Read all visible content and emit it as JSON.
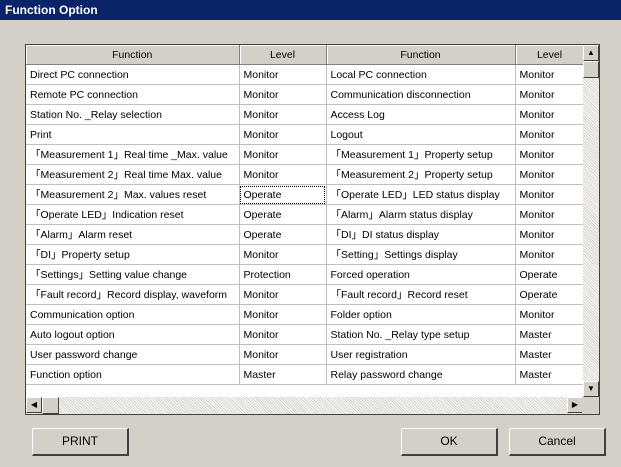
{
  "window": {
    "title": "Function Option"
  },
  "table": {
    "headers": [
      "Function",
      "Level",
      "Function",
      "Level"
    ],
    "rows": [
      [
        "Direct PC connection",
        "Monitor",
        "Local PC connection",
        "Monitor"
      ],
      [
        "Remote PC connection",
        "Monitor",
        "Communication disconnection",
        "Monitor"
      ],
      [
        "Station No. _Relay selection",
        "Monitor",
        "Access Log",
        "Monitor"
      ],
      [
        "Print",
        "Monitor",
        "Logout",
        "Monitor"
      ],
      [
        "「Measurement 1」Real time _Max. value",
        "Monitor",
        "「Measurement 1」Property setup",
        "Monitor"
      ],
      [
        "「Measurement 2」Real time  Max. value",
        "Monitor",
        "「Measurement 2」Property setup",
        "Monitor"
      ],
      [
        "「Measurement 2」Max. values reset",
        "Operate",
        "「Operate LED」LED status display",
        "Monitor"
      ],
      [
        "「Operate LED」Indication reset",
        "Operate",
        "「Alarm」Alarm status display",
        "Monitor"
      ],
      [
        "「Alarm」Alarm reset",
        "Operate",
        "「DI」DI status display",
        "Monitor"
      ],
      [
        "「DI」Property setup",
        "Monitor",
        "「Setting」Settings display",
        "Monitor"
      ],
      [
        "「Settings」Setting value change",
        "Protection",
        "Forced operation",
        "Operate"
      ],
      [
        "「Fault record」Record display, waveform",
        "Monitor",
        "「Fault record」Record reset",
        "Operate"
      ],
      [
        "Communication option",
        "Monitor",
        "Folder option",
        "Monitor"
      ],
      [
        "Auto logout option",
        "Monitor",
        "Station No. _Relay type setup",
        "Master"
      ],
      [
        "User password change",
        "Monitor",
        "User registration",
        "Master"
      ],
      [
        "Function option",
        "Master",
        "Relay password change",
        "Master"
      ]
    ]
  },
  "scrollbar": {
    "up_icon": "▲",
    "down_icon": "▼",
    "left_icon": "◀",
    "right_icon": "▶"
  },
  "buttons": {
    "print": "PRINT",
    "ok": "OK",
    "cancel": "Cancel"
  },
  "colors": {
    "titlebar": "#0a246a",
    "face": "#d4d0c8"
  }
}
